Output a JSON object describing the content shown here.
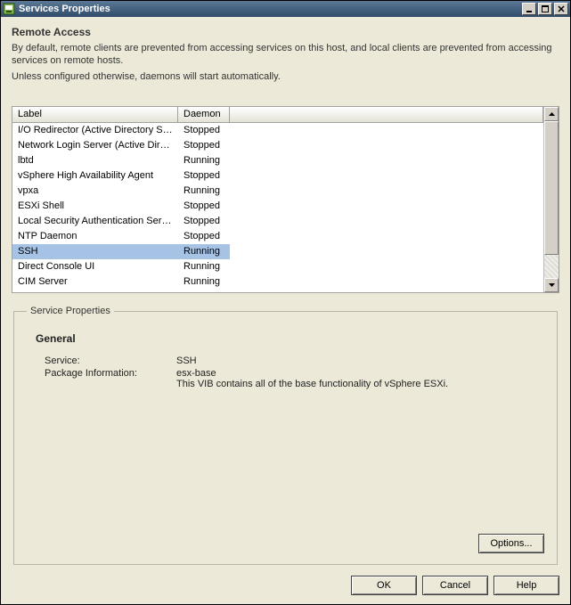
{
  "window": {
    "title": "Services Properties"
  },
  "section": {
    "heading": "Remote Access",
    "desc1": "By default, remote clients are prevented from accessing services on this host, and local clients are prevented from accessing services on remote hosts.",
    "desc2": "Unless configured otherwise, daemons will start automatically."
  },
  "table": {
    "headers": {
      "label": "Label",
      "daemon": "Daemon"
    },
    "rows": [
      {
        "label": "I/O Redirector (Active Directory Se...",
        "daemon": "Stopped"
      },
      {
        "label": "Network Login Server (Active Direc...",
        "daemon": "Stopped"
      },
      {
        "label": "lbtd",
        "daemon": "Running"
      },
      {
        "label": "vSphere High Availability Agent",
        "daemon": "Stopped"
      },
      {
        "label": "vpxa",
        "daemon": "Running"
      },
      {
        "label": "ESXi Shell",
        "daemon": "Stopped"
      },
      {
        "label": "Local Security Authentication Serv...",
        "daemon": "Stopped"
      },
      {
        "label": "NTP Daemon",
        "daemon": "Stopped"
      },
      {
        "label": "SSH",
        "daemon": "Running",
        "selected": true
      },
      {
        "label": "Direct Console UI",
        "daemon": "Running"
      },
      {
        "label": "CIM Server",
        "daemon": "Running"
      }
    ]
  },
  "serviceProps": {
    "legend": "Service Properties",
    "generalHeading": "General",
    "serviceKey": "Service:",
    "serviceVal": "SSH",
    "pkgKey": "Package Information:",
    "pkgVal1": "esx-base",
    "pkgVal2": "This VIB contains all of the base functionality of vSphere ESXi."
  },
  "buttons": {
    "options": "Options...",
    "ok": "OK",
    "cancel": "Cancel",
    "help": "Help"
  }
}
